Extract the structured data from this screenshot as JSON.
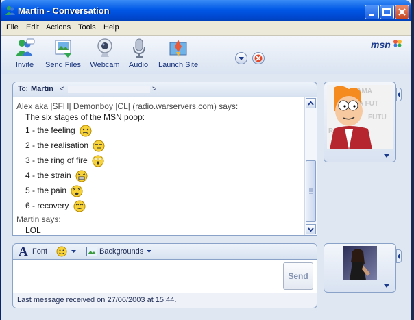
{
  "window": {
    "title": "Martin - Conversation"
  },
  "menu": [
    "File",
    "Edit",
    "Actions",
    "Tools",
    "Help"
  ],
  "toolbar": {
    "items": [
      {
        "label": "Invite",
        "icon": "invite-icon"
      },
      {
        "label": "Send Files",
        "icon": "send-files-icon"
      },
      {
        "label": "Webcam",
        "icon": "webcam-icon"
      },
      {
        "label": "Audio",
        "icon": "audio-icon"
      },
      {
        "label": "Launch Site",
        "icon": "launch-site-icon"
      }
    ],
    "logo": "msn"
  },
  "to": {
    "prefix": "To:",
    "name": "Martin",
    "open": "<",
    "close": ">"
  },
  "conversation": {
    "sender1": "Alex aka |SFH| Demonboy |CL| (radio.warservers.com) says:",
    "lines": [
      "The six stages of the MSN poop:",
      "1 - the feeling",
      "2 - the realisation",
      "3 - the ring of fire",
      "4 - the strain",
      "5 - the pain",
      "6 - recovery"
    ],
    "sender2": "Martin says:",
    "reply": "LOL"
  },
  "compose": {
    "font_label": "Font",
    "backgrounds_label": "Backgrounds",
    "send_label": "Send"
  },
  "status": {
    "text": "Last message received on 27/06/2003 at 15:44."
  },
  "colors": {
    "titlebar": "#0058e6",
    "link": "#18337a",
    "panel_border": "#8aa2c7"
  }
}
